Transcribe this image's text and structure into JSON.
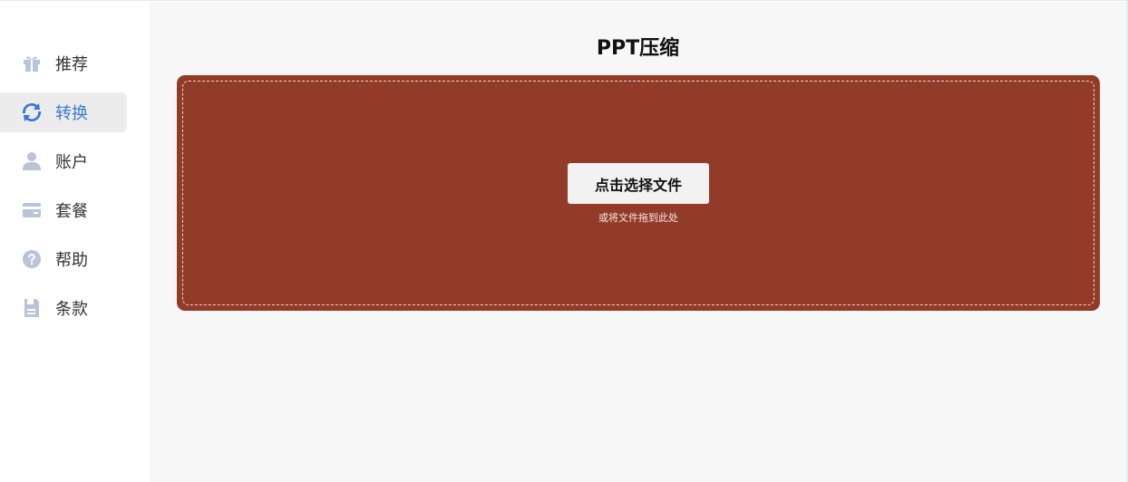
{
  "sidebar": {
    "items": [
      {
        "label": "推荐",
        "icon": "gift-icon",
        "active": false
      },
      {
        "label": "转换",
        "icon": "convert-icon",
        "active": true
      },
      {
        "label": "账户",
        "icon": "user-icon",
        "active": false
      },
      {
        "label": "套餐",
        "icon": "card-icon",
        "active": false
      },
      {
        "label": "帮助",
        "icon": "help-icon",
        "active": false
      },
      {
        "label": "条款",
        "icon": "document-icon",
        "active": false
      }
    ]
  },
  "main": {
    "title": "PPT压缩",
    "upload": {
      "button_label": "点击选择文件",
      "hint": "或将文件拖到此处"
    }
  },
  "colors": {
    "accent": "#3a78d6",
    "dropzone_bg": "#933b29",
    "icon_gray": "#b9c4d6",
    "active_bg": "#ececec"
  }
}
